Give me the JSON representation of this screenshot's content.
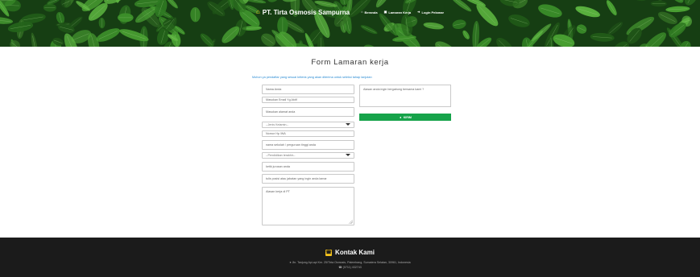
{
  "header": {
    "brand": "PT. Tirta Osmosis Sampurna",
    "brand_icon": "home-icon",
    "nav": [
      {
        "label": "Beranda",
        "icon": "home-icon"
      },
      {
        "label": "Lamaran Kerja",
        "icon": "briefcase-icon"
      },
      {
        "label": "Login Pelamar",
        "icon": "login-icon"
      }
    ],
    "colors": {
      "brand_icon": "#f4c21b",
      "banner": "#153a12"
    }
  },
  "form": {
    "title": "Form Lamaran kerja",
    "instruction": "Mohon ya pendaftar yang sesuai kriteria yang akan diterima untuk seleksi tahap lanjutan",
    "fields": {
      "nama": "Nama Anda",
      "email": "Masukan Email Yg Aktif",
      "alamat": "Masukan alamat anda",
      "jenis_kelamin": "--Jenis Kelamin--",
      "no_hp": "Nomor Hp /WA",
      "sekolah": "nama sekolah / perguruan tinggi anda",
      "pendidikan": "--Pendidikan terakhir--",
      "jurusan": "ketik jurusan anda",
      "posisi": "tulis posisi atau jabatan yang ingin anda lamar",
      "alasan": "Alasan kerja di PT"
    },
    "question_placeholder": "Alasan anda ingin bergabung bersama kami ?",
    "submit_label": "KIRIM",
    "submit_color": "#16a34a"
  },
  "footer": {
    "title": "Kontak Kami",
    "address": "Jln. Tanjung Api-api Km. 25/Tirta Osmosis, Palembang, Sumatera Selatan, 30961, Indonesia",
    "phone": "(0711) 432743"
  }
}
